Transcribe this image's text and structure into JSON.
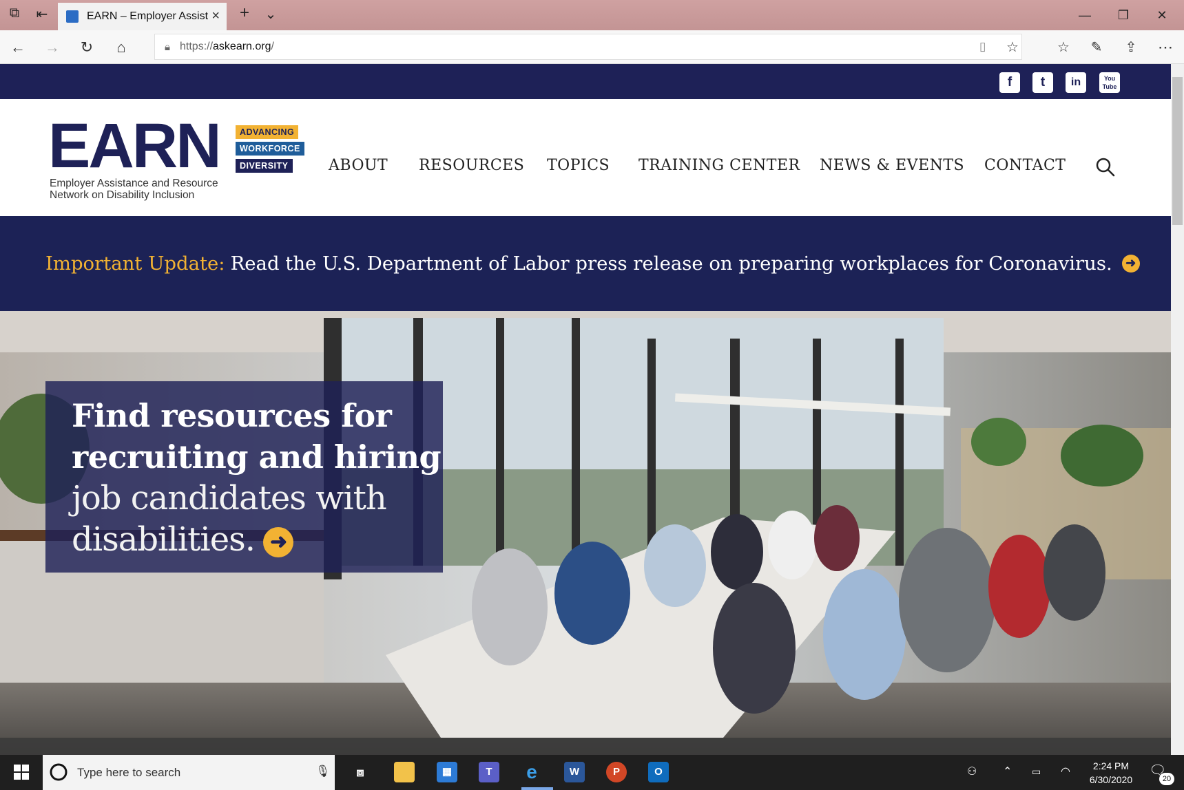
{
  "browser": {
    "tab_title": "EARN – Employer Assist",
    "new_tab": "+",
    "url_prefix": "https://",
    "url_domain": "askearn.org",
    "url_suffix": "/"
  },
  "site": {
    "social": [
      "f",
      "t",
      "in",
      "You Tube"
    ],
    "logo": {
      "wordmark": "EARN",
      "tags": [
        "ADVANCING",
        "WORKFORCE",
        "DIVERSITY"
      ],
      "sub1": "Employer Assistance and Resource",
      "sub2": "Network on Disability Inclusion"
    },
    "nav": [
      "ABOUT",
      "RESOURCES",
      "TOPICS",
      "TRAINING CENTER",
      "NEWS & EVENTS",
      "CONTACT"
    ],
    "alert": {
      "label": "Important Update:",
      "text": "Read the U.S. Department of Labor press release on preparing workplaces for Coronavirus."
    },
    "hero": {
      "line1": "Find resources for",
      "line2": "recruiting and hiring",
      "line3": "job candidates with",
      "line4": "disabilities."
    }
  },
  "taskbar": {
    "search_placeholder": "Type here to search",
    "time": "2:24 PM",
    "date": "6/30/2020",
    "notifications": "20"
  },
  "colors": {
    "navy": "#1e2157",
    "gold": "#f2b233",
    "blue_tag": "#1f5d9a"
  }
}
